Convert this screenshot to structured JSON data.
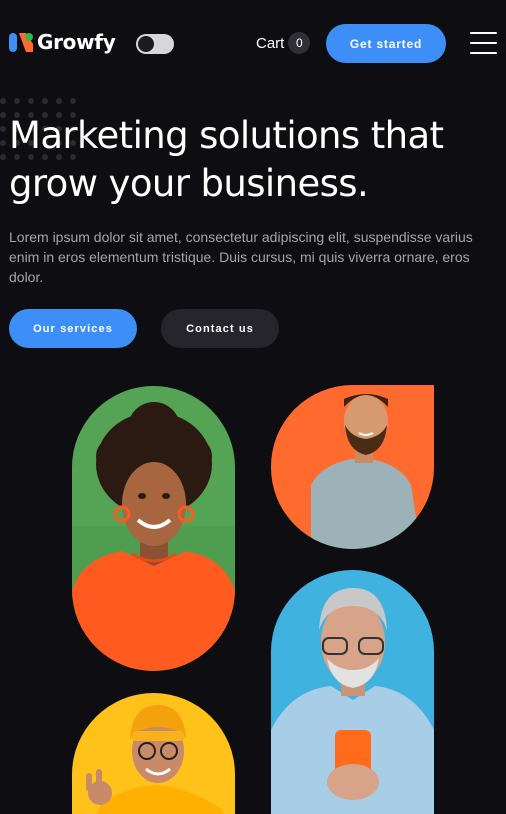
{
  "brand": {
    "name": "Growfy",
    "colors": {
      "blue": "#3d8ef6",
      "orange": "#ff6b2e",
      "green": "#38b44a",
      "background": "#0e0e12"
    }
  },
  "header": {
    "theme_toggle_icon": "toggle-switch",
    "cart_label": "Cart",
    "cart_count": "0",
    "cta_label": "Get started",
    "menu_icon": "hamburger-icon"
  },
  "hero": {
    "headline": "Marketing solutions that grow your business.",
    "description": "Lorem ipsum dolor sit amet, consectetur adipiscing elit, suspendisse varius enim in eros elementum tristique. Duis cursus, mi quis viverra ornare, eros dolor.",
    "primary_button": "Our services",
    "secondary_button": "Contact us"
  },
  "gallery": {
    "photos": [
      {
        "name": "woman-orange-sweater",
        "background": "#4f9d4f"
      },
      {
        "name": "bearded-man-tshirt",
        "background": "#ff6b2e"
      },
      {
        "name": "older-man-phone",
        "background": "#3fb2e0"
      },
      {
        "name": "man-yellow-beanie",
        "background": "#ffc21a"
      }
    ]
  }
}
